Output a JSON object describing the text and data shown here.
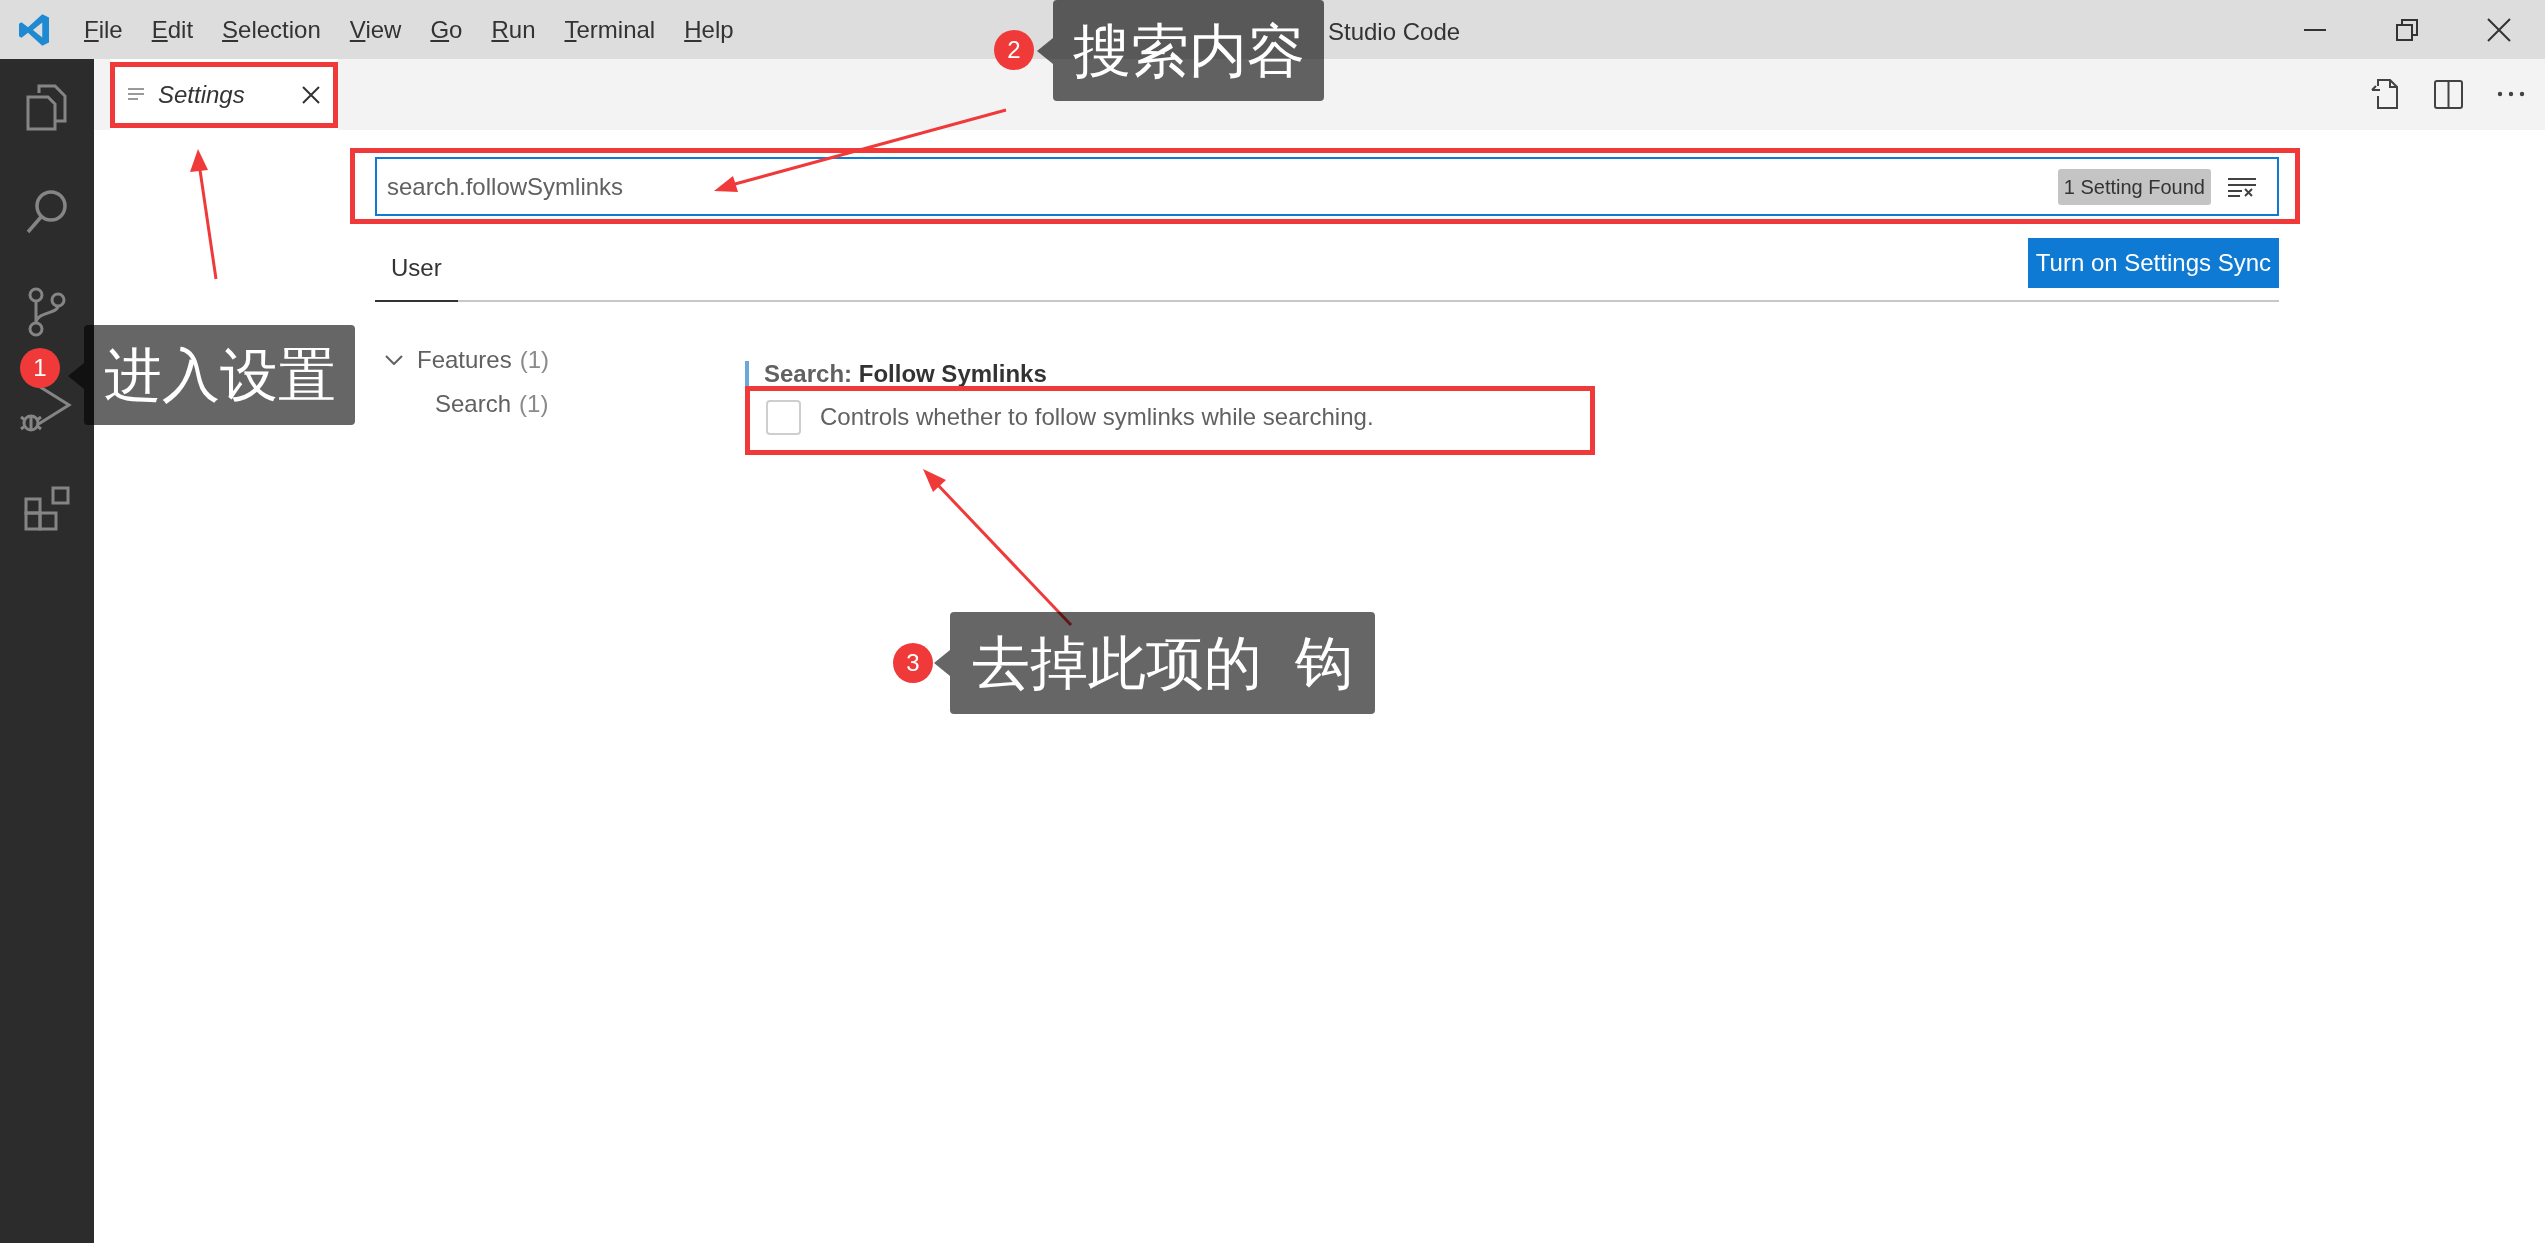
{
  "title_bar": {
    "menu": [
      "File",
      "Edit",
      "Selection",
      "View",
      "Go",
      "Run",
      "Terminal",
      "Help"
    ],
    "title": "Studio Code"
  },
  "editor_tabs": [
    {
      "label": "Settings",
      "selected": true
    }
  ],
  "search": {
    "value": "search.followSymlinks",
    "badge": "1 Setting Found"
  },
  "scope_tabs": [
    {
      "label": "User",
      "selected": true
    }
  ],
  "sync_button": "Turn on Settings Sync",
  "tree": [
    {
      "label": "Features",
      "count": "(1)",
      "expanded": true,
      "children": [
        {
          "label": "Search",
          "count": "(1)"
        }
      ]
    }
  ],
  "setting": {
    "category": "Search:",
    "title": "Follow Symlinks",
    "description": "Controls whether to follow symlinks while searching.",
    "checked": false
  },
  "annotations": [
    {
      "number": "1",
      "text": "进入设置"
    },
    {
      "number": "2",
      "text": "搜索内容"
    },
    {
      "number": "3",
      "text": "去掉此项的  钩"
    }
  ]
}
